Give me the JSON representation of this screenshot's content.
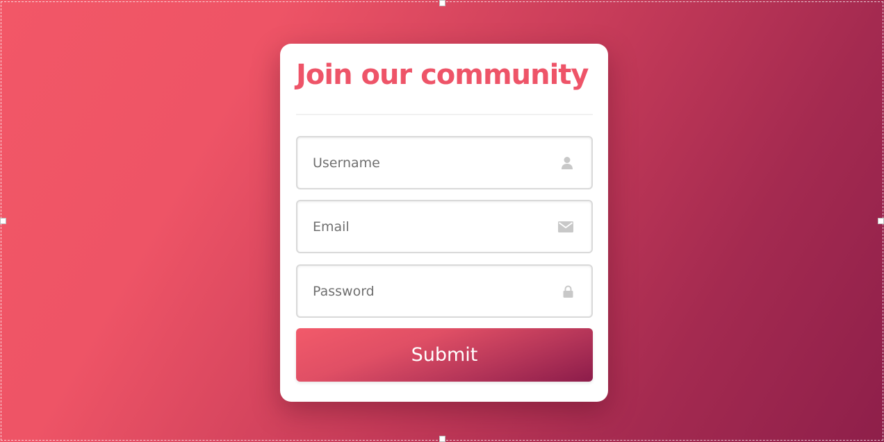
{
  "form": {
    "title": "Join our community",
    "fields": [
      {
        "placeholder": "Username",
        "icon": "user-icon"
      },
      {
        "placeholder": "Email",
        "icon": "envelope-icon"
      },
      {
        "placeholder": "Password",
        "icon": "lock-icon"
      }
    ],
    "submit_label": "Submit"
  },
  "colors": {
    "accent": "#ee5468",
    "background_start": "#f25767",
    "background_end": "#8e1f4a",
    "icon": "#c8c8c8"
  }
}
